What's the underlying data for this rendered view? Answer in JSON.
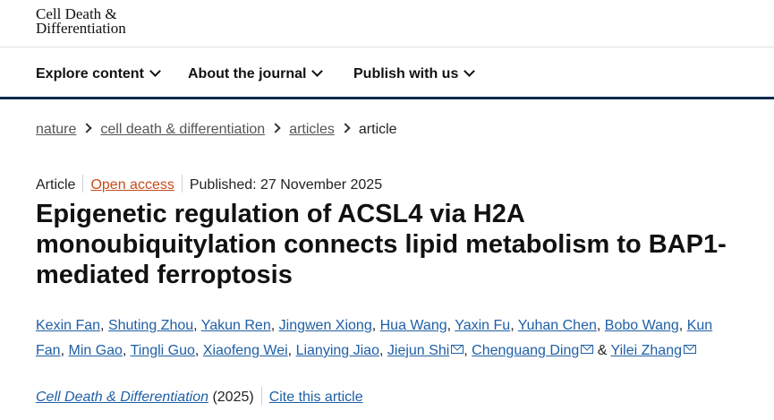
{
  "logo": {
    "line1": "Cell Death &",
    "line2": "Differentiation"
  },
  "nav": [
    {
      "label": "Explore content"
    },
    {
      "label": "About the journal"
    },
    {
      "label": "Publish with us"
    }
  ],
  "breadcrumb": {
    "items": [
      "nature",
      "cell death & differentiation",
      "articles"
    ],
    "current": "article"
  },
  "meta": {
    "type": "Article",
    "access": "Open access",
    "published": "Published: 27 November 2025"
  },
  "title": "Epigenetic regulation of ACSL4 via H2A monoubiquitylation connects lipid metabolism to BAP1-mediated ferroptosis",
  "authors": [
    "Kexin Fan",
    "Shuting Zhou",
    "Yakun Ren",
    "Jingwen Xiong",
    "Hua Wang",
    "Yaxin Fu",
    "Yuhan Chen",
    "Bobo Wang",
    "Kun Fan",
    "Min Gao",
    "Tingli Guo",
    "Xiaofeng Wei",
    "Lianying Jiao",
    "Jiejun Shi",
    "Chenguang Ding",
    "Yilei Zhang"
  ],
  "authors_sep": ",",
  "authors_and": "&",
  "citation": {
    "journal": "Cell Death & Differentiation",
    "year": "(2025)",
    "cite_label": "Cite this article"
  },
  "colors": {
    "link": "#1f5fa5",
    "open_access": "#c84b1c",
    "nav_border": "#0a2a4f"
  }
}
